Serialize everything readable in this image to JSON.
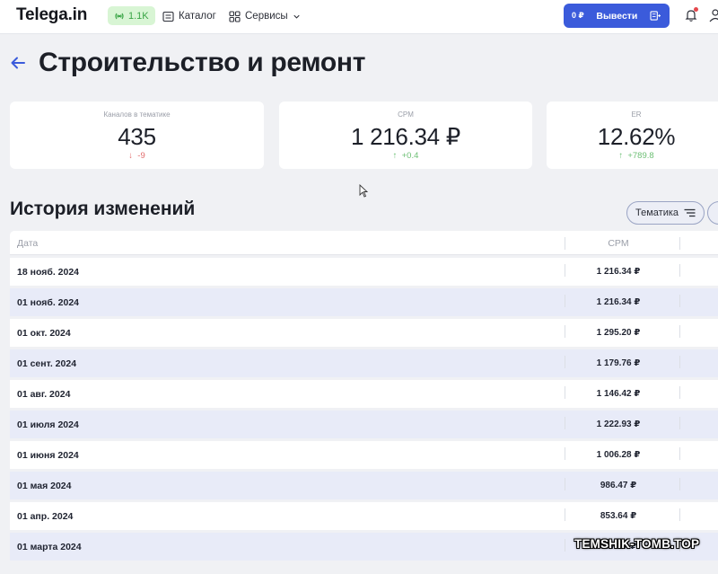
{
  "header": {
    "logo": "Telega.in",
    "badge_count": "1.1K",
    "nav_catalog": "Каталог",
    "nav_services": "Сервисы",
    "balance": "0 ₽",
    "withdraw_label": "Вывести"
  },
  "page": {
    "title": "Строительство и ремонт"
  },
  "stats": [
    {
      "label": "Каналов в тематике",
      "value": "435",
      "delta": "-9",
      "direction": "down"
    },
    {
      "label": "CPM",
      "value": "1 216.34 ₽",
      "delta": "+0.4",
      "direction": "up"
    },
    {
      "label": "ER",
      "value": "12.62%",
      "delta": "+789.8",
      "direction": "up"
    }
  ],
  "history": {
    "title": "История изменений",
    "filter_label": "Тематика",
    "columns": {
      "date": "Дата",
      "cpm": "CPM"
    },
    "rows": [
      {
        "date": "18 нояб. 2024",
        "cpm": "1 216.34 ₽"
      },
      {
        "date": "01 нояб. 2024",
        "cpm": "1 216.34 ₽"
      },
      {
        "date": "01 окт. 2024",
        "cpm": "1 295.20 ₽"
      },
      {
        "date": "01 сент. 2024",
        "cpm": "1 179.76 ₽"
      },
      {
        "date": "01 авг. 2024",
        "cpm": "1 146.42 ₽"
      },
      {
        "date": "01 июля 2024",
        "cpm": "1 222.93 ₽"
      },
      {
        "date": "01 июня 2024",
        "cpm": "1 006.28 ₽"
      },
      {
        "date": "01 мая 2024",
        "cpm": "986.47 ₽"
      },
      {
        "date": "01 апр. 2024",
        "cpm": "853.64 ₽"
      },
      {
        "date": "01 марта 2024",
        "cpm": "777.17 ₽"
      }
    ]
  },
  "watermark": "TEMSHIK-TOMB.TOP",
  "colors": {
    "accent": "#3b5bdb",
    "badge_bg": "#d8f5d4",
    "delta_up": "#6cbf74",
    "delta_down": "#e26b6b",
    "row_alt": "#e8ebf8"
  }
}
